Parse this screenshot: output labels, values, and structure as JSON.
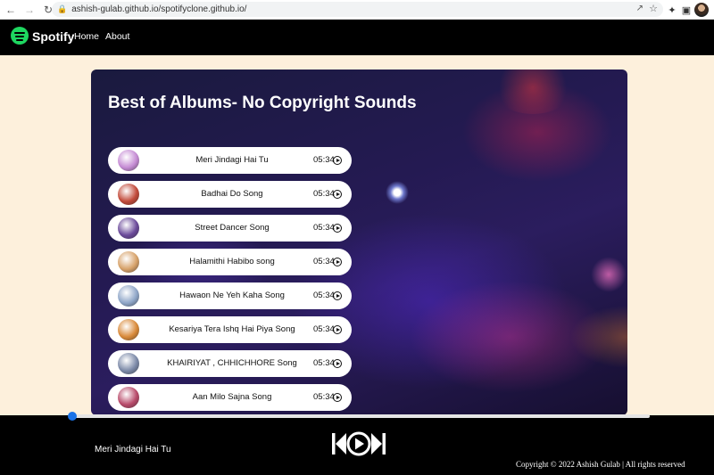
{
  "browser": {
    "url": "ashish-gulab.github.io/spotifyclone.github.io/"
  },
  "navbar": {
    "brand": "Spotify",
    "links": [
      "Home",
      "About"
    ]
  },
  "card": {
    "title": "Best of Albums- No Copyright Sounds"
  },
  "songs": [
    {
      "name": "Meri Jindagi Hai Tu",
      "duration": "05:34",
      "cover_color": "#c58bd4"
    },
    {
      "name": "Badhai Do Song",
      "duration": "05:34",
      "cover_color": "#c24a3a"
    },
    {
      "name": "Street Dancer Song",
      "duration": "05:34",
      "cover_color": "#6b4a9a"
    },
    {
      "name": "Halamithi Habibo song",
      "duration": "05:34",
      "cover_color": "#d7a26a"
    },
    {
      "name": "Hawaon Ne Yeh Kaha Song",
      "duration": "05:34",
      "cover_color": "#8fa6c8"
    },
    {
      "name": "Kesariya Tera Ishq Hai Piya Song",
      "duration": "05:34",
      "cover_color": "#d98a3a"
    },
    {
      "name": "KHAIRIYAT , CHHICHHORE Song",
      "duration": "05:34",
      "cover_color": "#7c8aa8"
    },
    {
      "name": "Aan Milo Sajna Song",
      "duration": "05:34",
      "cover_color": "#b84a6a"
    }
  ],
  "player": {
    "now_playing": "Meri Jindagi Hai Tu",
    "progress": 0,
    "copyright": "Copyright © 2022 Ashish Gulab | All rights reserved"
  },
  "colors": {
    "accent": "#1ed760",
    "background": "#fdf0dc",
    "progress": "#1a73e8"
  }
}
